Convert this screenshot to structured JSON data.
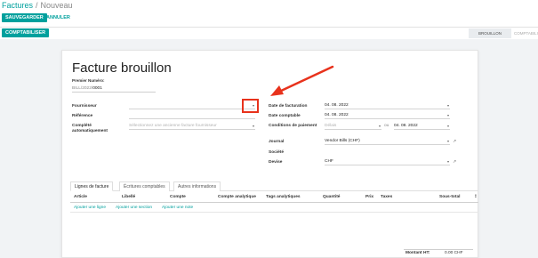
{
  "breadcrumb": {
    "parent": "Factures",
    "separator": "/",
    "current": "Nouveau"
  },
  "toolbar": {
    "save_label": "SAUVEGARDER",
    "discard_label": "ANNULER",
    "post_label": "COMPTABILISER"
  },
  "status": {
    "active": "BROUILLON",
    "next": "COMPTABILISÉ"
  },
  "form": {
    "title": "Facture brouillon",
    "first_number_label": "Premier Numéro:",
    "first_number_prefix": "BILL/2022/",
    "first_number_value": "0001",
    "left": {
      "vendor_label": "Fournisseur",
      "reference_label": "Référence",
      "autocomplete_label": "Complété automatiquement",
      "autocomplete_placeholder": "Sélectionnez une ancienne facture fournisseur"
    },
    "right": {
      "invoice_date_label": "Date de facturation",
      "invoice_date_value": "04. 08. 2022",
      "accounting_date_label": "Date comptable",
      "accounting_date_value": "04. 08. 2022",
      "payment_terms_label": "Conditions de paiement",
      "payment_terms_placeholder": "Délais",
      "or_text": "ou",
      "due_date_value": "04. 08. 2022",
      "journal_label": "Journal",
      "journal_value": "Vendor Bills (CHF)",
      "company_label": "Société",
      "currency_label": "Devise",
      "currency_value": "CHF"
    }
  },
  "tabs": [
    "Lignes de facture",
    "Écritures comptables",
    "Autres informations"
  ],
  "table": {
    "headers": [
      "Article",
      "Libellé",
      "Compte",
      "Compte analytique",
      "Tags analytiques",
      "Quantité",
      "Prix",
      "Taxes",
      "Sous-total"
    ],
    "add_links": [
      "Ajouter une ligne",
      "Ajouter une section",
      "Ajouter une note"
    ]
  },
  "totals": {
    "untaxed_label": "Montant HT:",
    "untaxed_value": "0.00 CHF"
  },
  "colors": {
    "accent": "#00a09d",
    "annotation": "#e8321c"
  }
}
